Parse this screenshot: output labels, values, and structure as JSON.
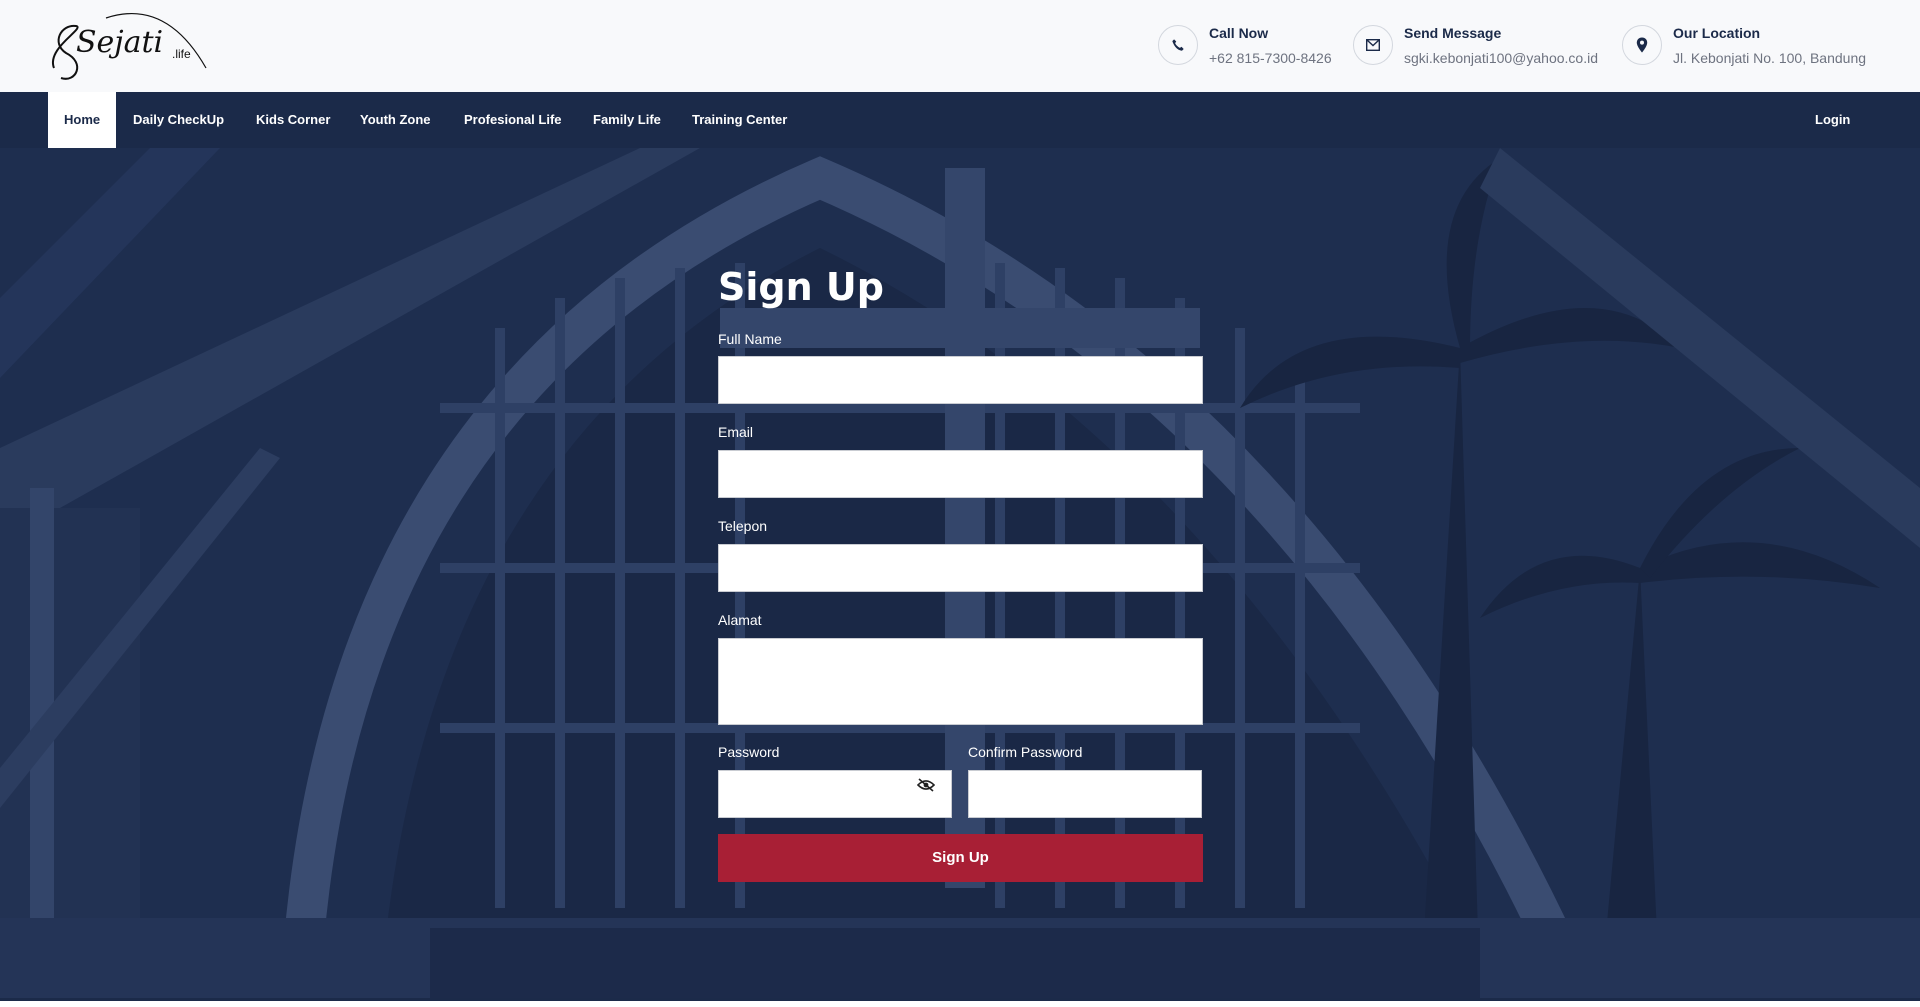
{
  "logo": {
    "script_text": "Sejati",
    "suffix": ".life"
  },
  "contacts": {
    "call": {
      "title": "Call Now",
      "value": "+62 815-7300-8426",
      "icon": "phone-icon"
    },
    "message": {
      "title": "Send Message",
      "value": "sgki.kebonjati100@yahoo.co.id",
      "icon": "envelope-icon"
    },
    "location": {
      "title": "Our Location",
      "value": "Jl. Kebonjati No. 100, Bandung",
      "icon": "map-pin-icon"
    }
  },
  "nav": {
    "items": [
      {
        "label": "Home",
        "active": true
      },
      {
        "label": "Daily CheckUp"
      },
      {
        "label": "Kids Corner"
      },
      {
        "label": "Youth Zone"
      },
      {
        "label": "Profesional Life"
      },
      {
        "label": "Family Life"
      },
      {
        "label": "Training Center"
      }
    ],
    "login": "Login"
  },
  "form": {
    "title": "Sign Up",
    "full_name_label": "Full Name",
    "full_name_value": "",
    "email_label": "Email",
    "email_value": "",
    "telepon_label": "Telepon",
    "telepon_value": "",
    "alamat_label": "Alamat",
    "alamat_value": "",
    "password_label": "Password",
    "password_value": "",
    "password_icon": "eye-slash-icon",
    "confirm_password_label": "Confirm Password",
    "confirm_password_value": "",
    "submit_label": "Sign Up"
  },
  "colors": {
    "navy": "#1b2a49",
    "hero_overlay": "#1e2e4f",
    "accent": "#a81f35",
    "white": "#ffffff"
  }
}
